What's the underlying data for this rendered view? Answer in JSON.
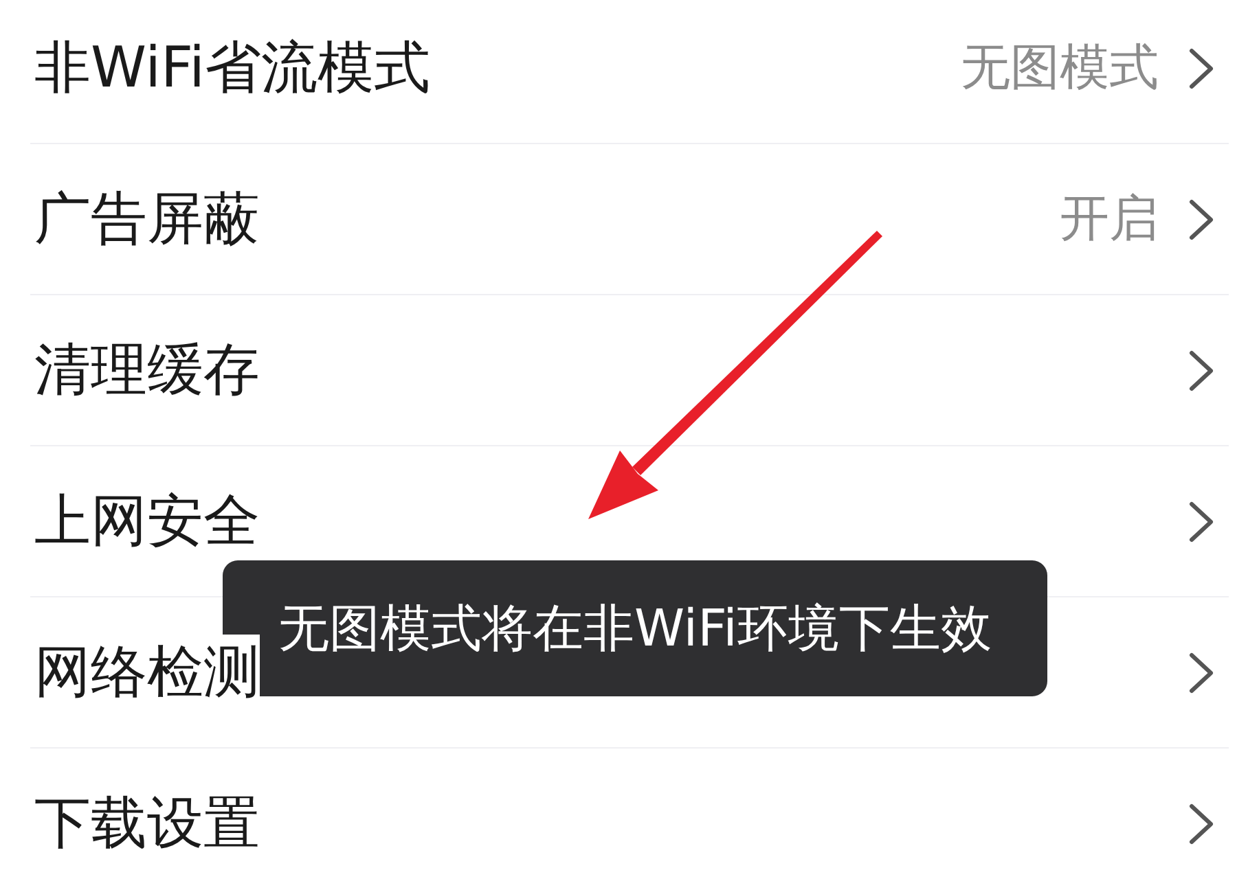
{
  "settings": [
    {
      "label": "非WiFi省流模式",
      "value": "无图模式"
    },
    {
      "label": "广告屏蔽",
      "value": "开启"
    },
    {
      "label": "清理缓存"
    },
    {
      "label": "上网安全"
    },
    {
      "label": "网络检测"
    },
    {
      "label": "下载设置"
    }
  ],
  "toast": {
    "text": "无图模式将在非WiFi环境下生效"
  }
}
